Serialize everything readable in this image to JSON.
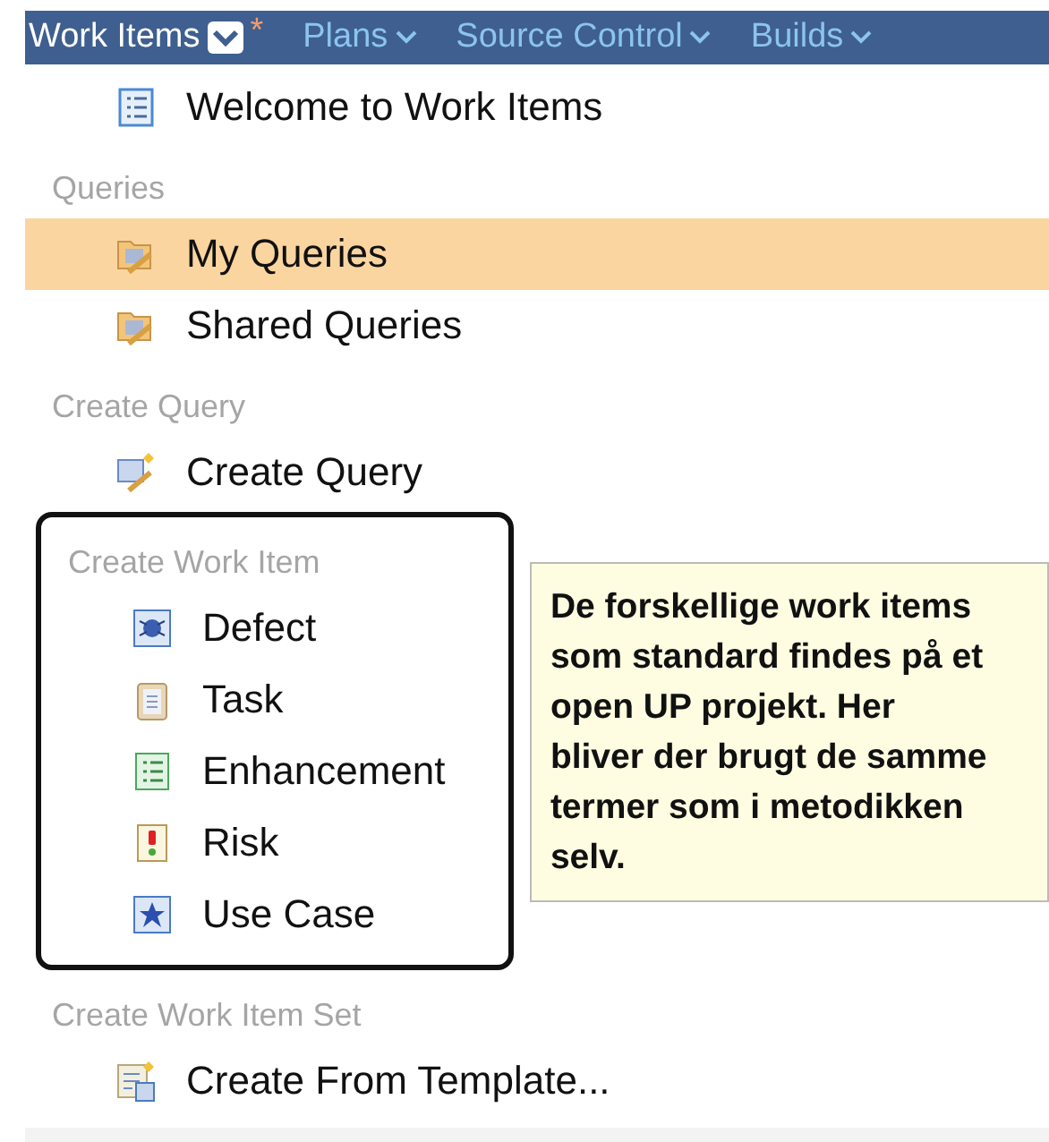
{
  "menu_bar": {
    "tabs": [
      {
        "label": "Work Items",
        "selected": true,
        "modified_mark": "*"
      },
      {
        "label": "Plans",
        "selected": false
      },
      {
        "label": "Source Control",
        "selected": false
      },
      {
        "label": "Builds",
        "selected": false
      }
    ]
  },
  "sections": [
    {
      "items": [
        {
          "label": "Welcome to Work Items",
          "kind": "welcome",
          "selected": false
        }
      ]
    },
    {
      "header": "Queries",
      "items": [
        {
          "label": "My Queries",
          "kind": "query",
          "selected": true
        },
        {
          "label": "Shared Queries",
          "kind": "query",
          "selected": false
        }
      ]
    },
    {
      "header": "Create Query",
      "items": [
        {
          "label": "Create Query",
          "kind": "create-query",
          "selected": false
        }
      ]
    },
    {
      "header": "Create Work Item",
      "items": [
        {
          "label": "Defect",
          "kind": "defect",
          "selected": false
        },
        {
          "label": "Task",
          "kind": "task",
          "selected": false
        },
        {
          "label": "Enhancement",
          "kind": "enhancement",
          "selected": false
        },
        {
          "label": "Risk",
          "kind": "risk",
          "selected": false
        },
        {
          "label": "Use Case",
          "kind": "usecase",
          "selected": false
        }
      ],
      "note": "De forskellige work items som standard findes på et open UP projekt. Her bliver der brugt de samme termer som i metodikken selv."
    },
    {
      "header": "Create Work Item Set",
      "items": [
        {
          "label": "Create From Template...",
          "kind": "template",
          "selected": false
        }
      ]
    }
  ]
}
